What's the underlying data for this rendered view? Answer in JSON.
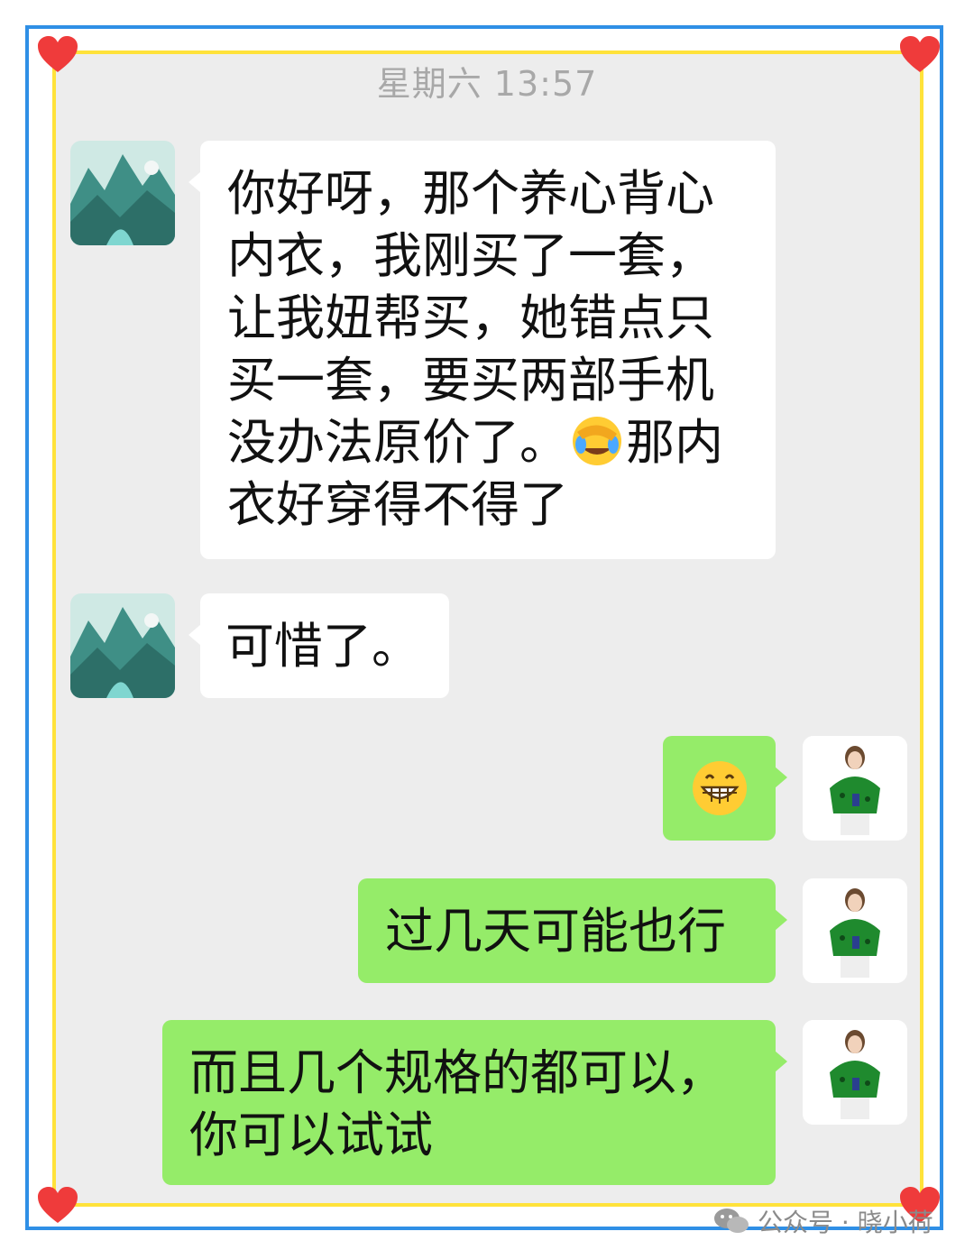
{
  "timestamp": "星期六 13:57",
  "messages": [
    {
      "side": "left",
      "text_before": "你好呀，那个养心背心内衣，我刚买了一套，让我妞帮买，她错点只买一套，要买两部手机没办法原价了。",
      "emoji": "facepalm-laughing-emoji",
      "text_after": "那内衣好穿得不得了"
    },
    {
      "side": "left",
      "text": "可惜了。"
    },
    {
      "side": "right",
      "emoji": "grinning-emoji"
    },
    {
      "side": "right",
      "text": "过几天可能也行"
    },
    {
      "side": "right",
      "text": "而且几个规格的都可以，你可以试试"
    }
  ],
  "watermark": {
    "icon": "wechat-icon",
    "text": "公众号 · 晓小荷"
  },
  "colors": {
    "outer_border": "#2f8fe6",
    "inner_border": "#ffe23a",
    "chat_background": "#ededed",
    "incoming_bubble": "#ffffff",
    "outgoing_bubble": "#95ec69",
    "heart": "#ef3b3b"
  }
}
